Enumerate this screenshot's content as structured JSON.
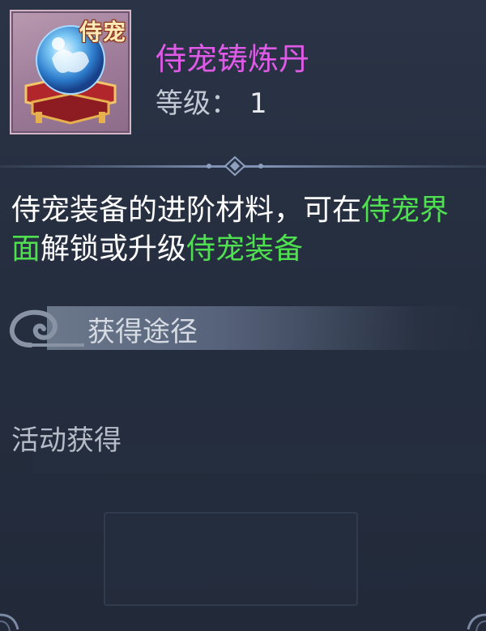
{
  "item": {
    "badge": "侍宠",
    "name": "侍宠铸炼丹",
    "level_label": "等级：",
    "level_value": "1"
  },
  "description": {
    "part1": "侍宠装备的进阶材料，可在",
    "link1": "侍宠界面",
    "part2": "解锁或升级",
    "link2": "侍宠装备"
  },
  "source": {
    "title": "获得途径",
    "items": [
      "活动获得"
    ]
  },
  "colors": {
    "item_name": "#e05ae8",
    "highlight": "#4fe04f",
    "panel_bg": "#252e3f"
  }
}
